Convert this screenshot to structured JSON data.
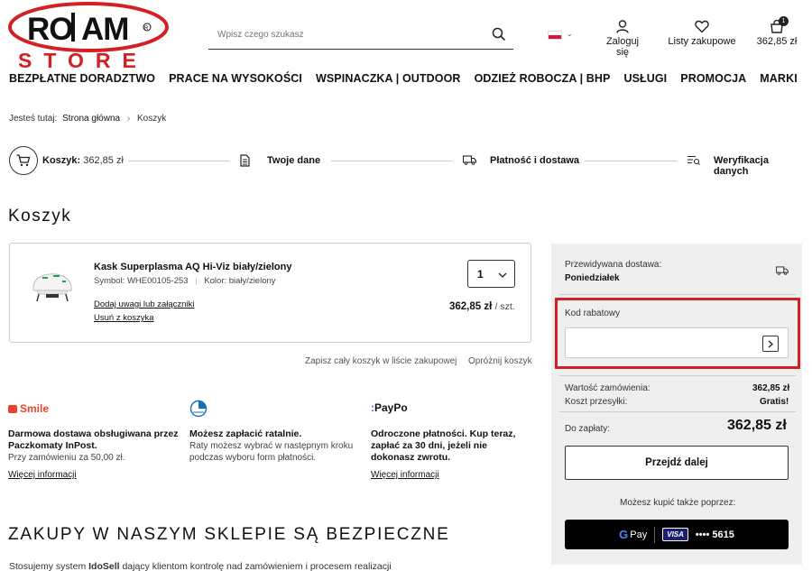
{
  "header": {
    "logo_top": "ROJAM",
    "logo_bottom": "STORE",
    "search_placeholder": "Wpisz czego szukasz",
    "login_label": "Zaloguj się",
    "lists_label": "Listy zakupowe",
    "cart_total": "362,85 zł",
    "cart_count": "1"
  },
  "nav": {
    "items": [
      "BEZPŁATNE DORADZTWO",
      "PRACE NA WYSOKOŚCI",
      "WSPINACZKA | OUTDOOR",
      "ODZIEŻ ROBOCZA | BHP",
      "USŁUGI",
      "PROMOCJA",
      "MARKI"
    ]
  },
  "breadcrumb": {
    "prefix": "Jesteś tutaj:",
    "home": "Strona główna",
    "separator": "›",
    "current": "Koszyk"
  },
  "steps": {
    "cart_label": "Koszyk:",
    "cart_value": "362,85 zł",
    "step2": "Twoje dane",
    "step3": "Płatność i dostawa",
    "step4": "Weryfikacja danych"
  },
  "page_title": "Koszyk",
  "product": {
    "name": "Kask Superplasma AQ Hi-Viz biały/zielony",
    "symbol": "Symbol: WHE00105-253",
    "color": "Kolor: biały/zielony",
    "add_note": "Dodaj uwagi lub załączniki",
    "remove": "Usuń z koszyka",
    "quantity": "1",
    "price": "362,85 zł",
    "unit": "/ szt."
  },
  "cart_actions": {
    "save": "Zapisz cały koszyk w liście zakupowej",
    "empty": "Opróżnij koszyk"
  },
  "info": [
    {
      "brand": "Smile",
      "title": "Darmowa dostawa obsługiwana przez Paczkomaty InPost.",
      "sub": "Przy zamówieniu za 50,00 zł.",
      "link": "Więcej informacji"
    },
    {
      "brand": "",
      "title": "Możesz zapłacić ratalnie.",
      "sub": "Raty możesz wybrać w następnym kroku podczas wyboru form płatności.",
      "link": ""
    },
    {
      "brand": "PayPo",
      "title": "Odroczone płatności. Kup teraz, zapłać za 30 dni, jeżeli nie dokonasz zwrotu.",
      "sub": "",
      "link": "Więcej informacji"
    }
  ],
  "secure": {
    "heading": "ZAKUPY W NASZYM SKLEPIE SĄ BEZPIECZNE",
    "text_pre": "Stosujemy system ",
    "text_brand": "IdoSell",
    "text_post": " dający klientom kontrolę nad zamówieniem i procesem realizacji"
  },
  "summary": {
    "delivery_label": "Przewidywana dostawa:",
    "delivery_day": "Poniedziałek",
    "coupon_label": "Kod rabatowy",
    "order_value_label": "Wartość zamówienia:",
    "order_value": "362,85 zł",
    "shipping_label": "Koszt przesyłki:",
    "shipping_value": "Gratis!",
    "to_pay_label": "Do zapłaty:",
    "to_pay_value": "362,85 zł",
    "next_button": "Przejdź dalej",
    "alt_pay_label": "Możesz kupić także poprzez:",
    "gpay_label": "Pay",
    "card_brand": "VISA",
    "card_digits": "•••• 5615"
  },
  "colors": {
    "brand_red": "#d32024",
    "highlight": "#d32024",
    "summary_bg": "#efefef"
  }
}
